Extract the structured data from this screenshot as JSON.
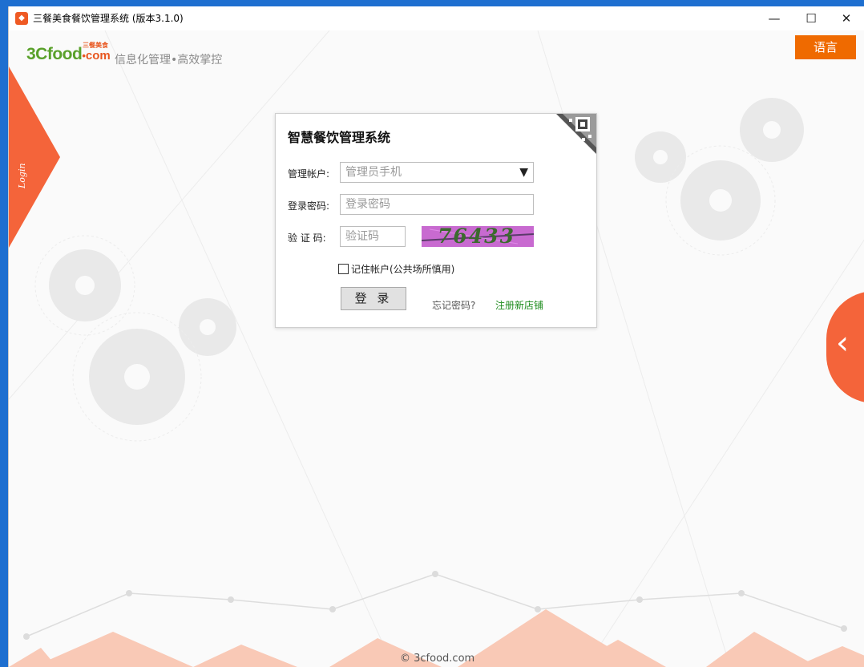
{
  "window": {
    "title": "三餐美食餐饮管理系统 (版本3.1.0)",
    "app_icon": "app-logo-icon",
    "minimize_label": "—",
    "maximize_label": "☐",
    "close_label": "✕"
  },
  "header": {
    "logo_main": "3Cfood",
    "logo_dot": "•",
    "logo_com": "com",
    "logo_cn": "三餐美食",
    "slogan": "信息化管理•高效掌控",
    "language_button": "语言"
  },
  "side_tab": {
    "label": "Login"
  },
  "side_arrow": {
    "label": "‹"
  },
  "login_panel": {
    "title": "智慧餐饮管理系统",
    "account_label": "管理帐户:",
    "account_placeholder": "管理员手机",
    "dropdown_arrow": "▼",
    "password_label": "登录密码:",
    "password_placeholder": "登录密码",
    "captcha_label": "验 证 码:",
    "captcha_placeholder": "验证码",
    "captcha_text": "76433",
    "remember_label": "记住帐户(公共场所慎用)",
    "remember_checked": false,
    "login_button": "登 录",
    "forgot_link": "忘记密码?",
    "register_link": "注册新店铺"
  },
  "footer": {
    "copyright": "© 3cfood.com"
  },
  "colors": {
    "accent": "#ef6a00",
    "side_orange": "#f4643a",
    "logo_green": "#5aa12b",
    "register_green": "#1a8a1a",
    "captcha_bg": "#c86ad0"
  }
}
